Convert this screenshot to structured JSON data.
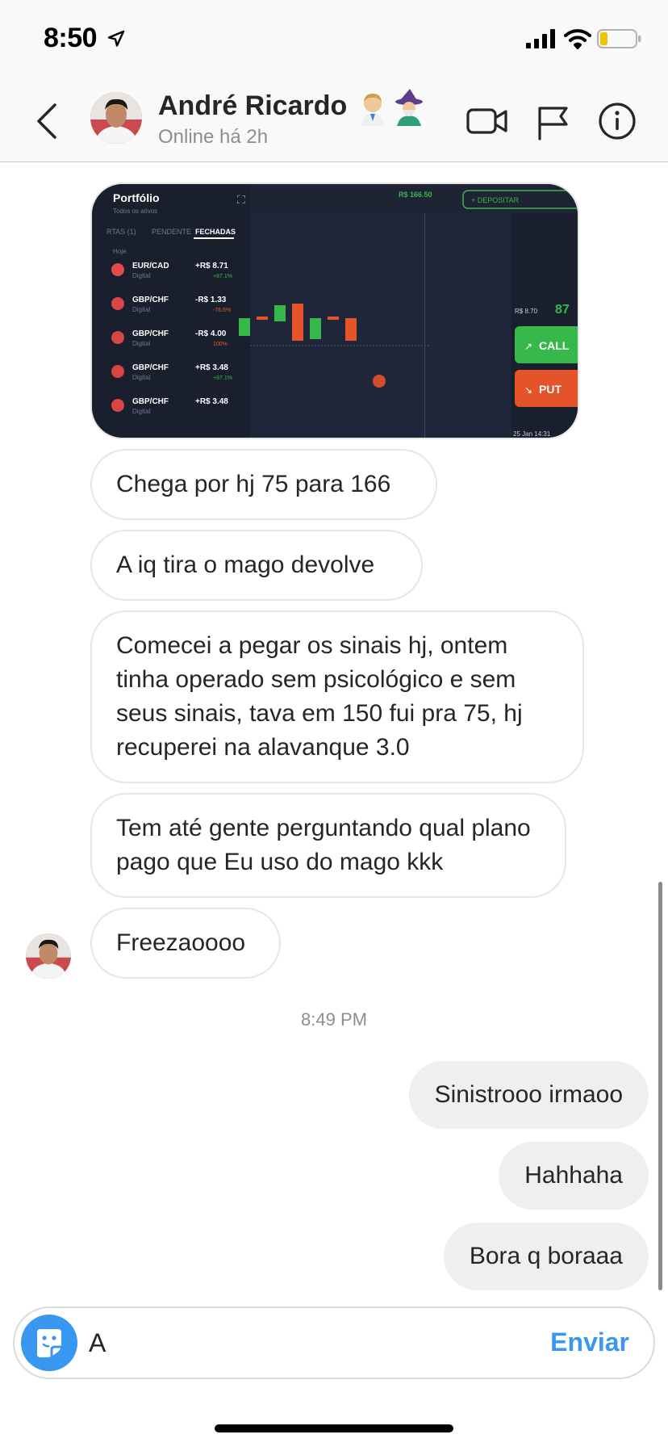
{
  "status_bar": {
    "time": "8:50"
  },
  "header": {
    "name": "André Ricardo",
    "status": "Online há 2h",
    "emoji_icons": [
      "doctor-emoji",
      "mage-emoji"
    ]
  },
  "photo": {
    "title": "Portfólio",
    "subtitle": "Todos os ativos",
    "tabs": [
      "RTAS (1)",
      "PENDENTE",
      "FECHADAS"
    ],
    "section": "Hoje",
    "trades": [
      {
        "pair": "EUR/CAD",
        "kind": "Digital",
        "value": "+R$ 8.71",
        "pct": "+87.1%",
        "positive": true
      },
      {
        "pair": "GBP/CHF",
        "kind": "Digital",
        "value": "-R$ 1.33",
        "pct": "-76.6%",
        "positive": false
      },
      {
        "pair": "GBP/CHF",
        "kind": "Digital",
        "value": "-R$ 4.00",
        "pct": "100%",
        "positive": false
      },
      {
        "pair": "GBP/CHF",
        "kind": "Digital",
        "value": "+R$ 3.48",
        "pct": "+87.1%",
        "positive": true
      },
      {
        "pair": "GBP/CHF",
        "kind": "Digital",
        "value": "+R$ 3.48",
        "pct": "",
        "positive": true
      }
    ],
    "balance": "R$ 166.50",
    "deposit": "+ DEPOSITAR",
    "payout": "R$ 8.70",
    "payout_pct": "87",
    "call": "CALL",
    "put": "PUT",
    "date_label": "25 Jan 14:31"
  },
  "messages": {
    "incoming": [
      "Chega por hj 75 para 166",
      "A iq tira o mago devolve",
      "Comecei a pegar os sinais hj, ontem tinha operado sem psicológico e sem seus sinais, tava em 150 fui pra 75, hj recuperei na alavanque 3.0",
      "Tem até gente perguntando qual plano pago que Eu uso do mago kkk",
      "Freezaoooo"
    ],
    "timestamp": "8:49 PM",
    "outgoing": [
      "Sinistrooo irmaoo",
      "Hahhaha",
      "Bora q boraaa"
    ]
  },
  "composer": {
    "value": "A",
    "send_label": "Enviar"
  },
  "colors": {
    "accent": "#3897f0",
    "call": "#36b84a",
    "put": "#e5532b",
    "bubble_out": "#efefef"
  }
}
